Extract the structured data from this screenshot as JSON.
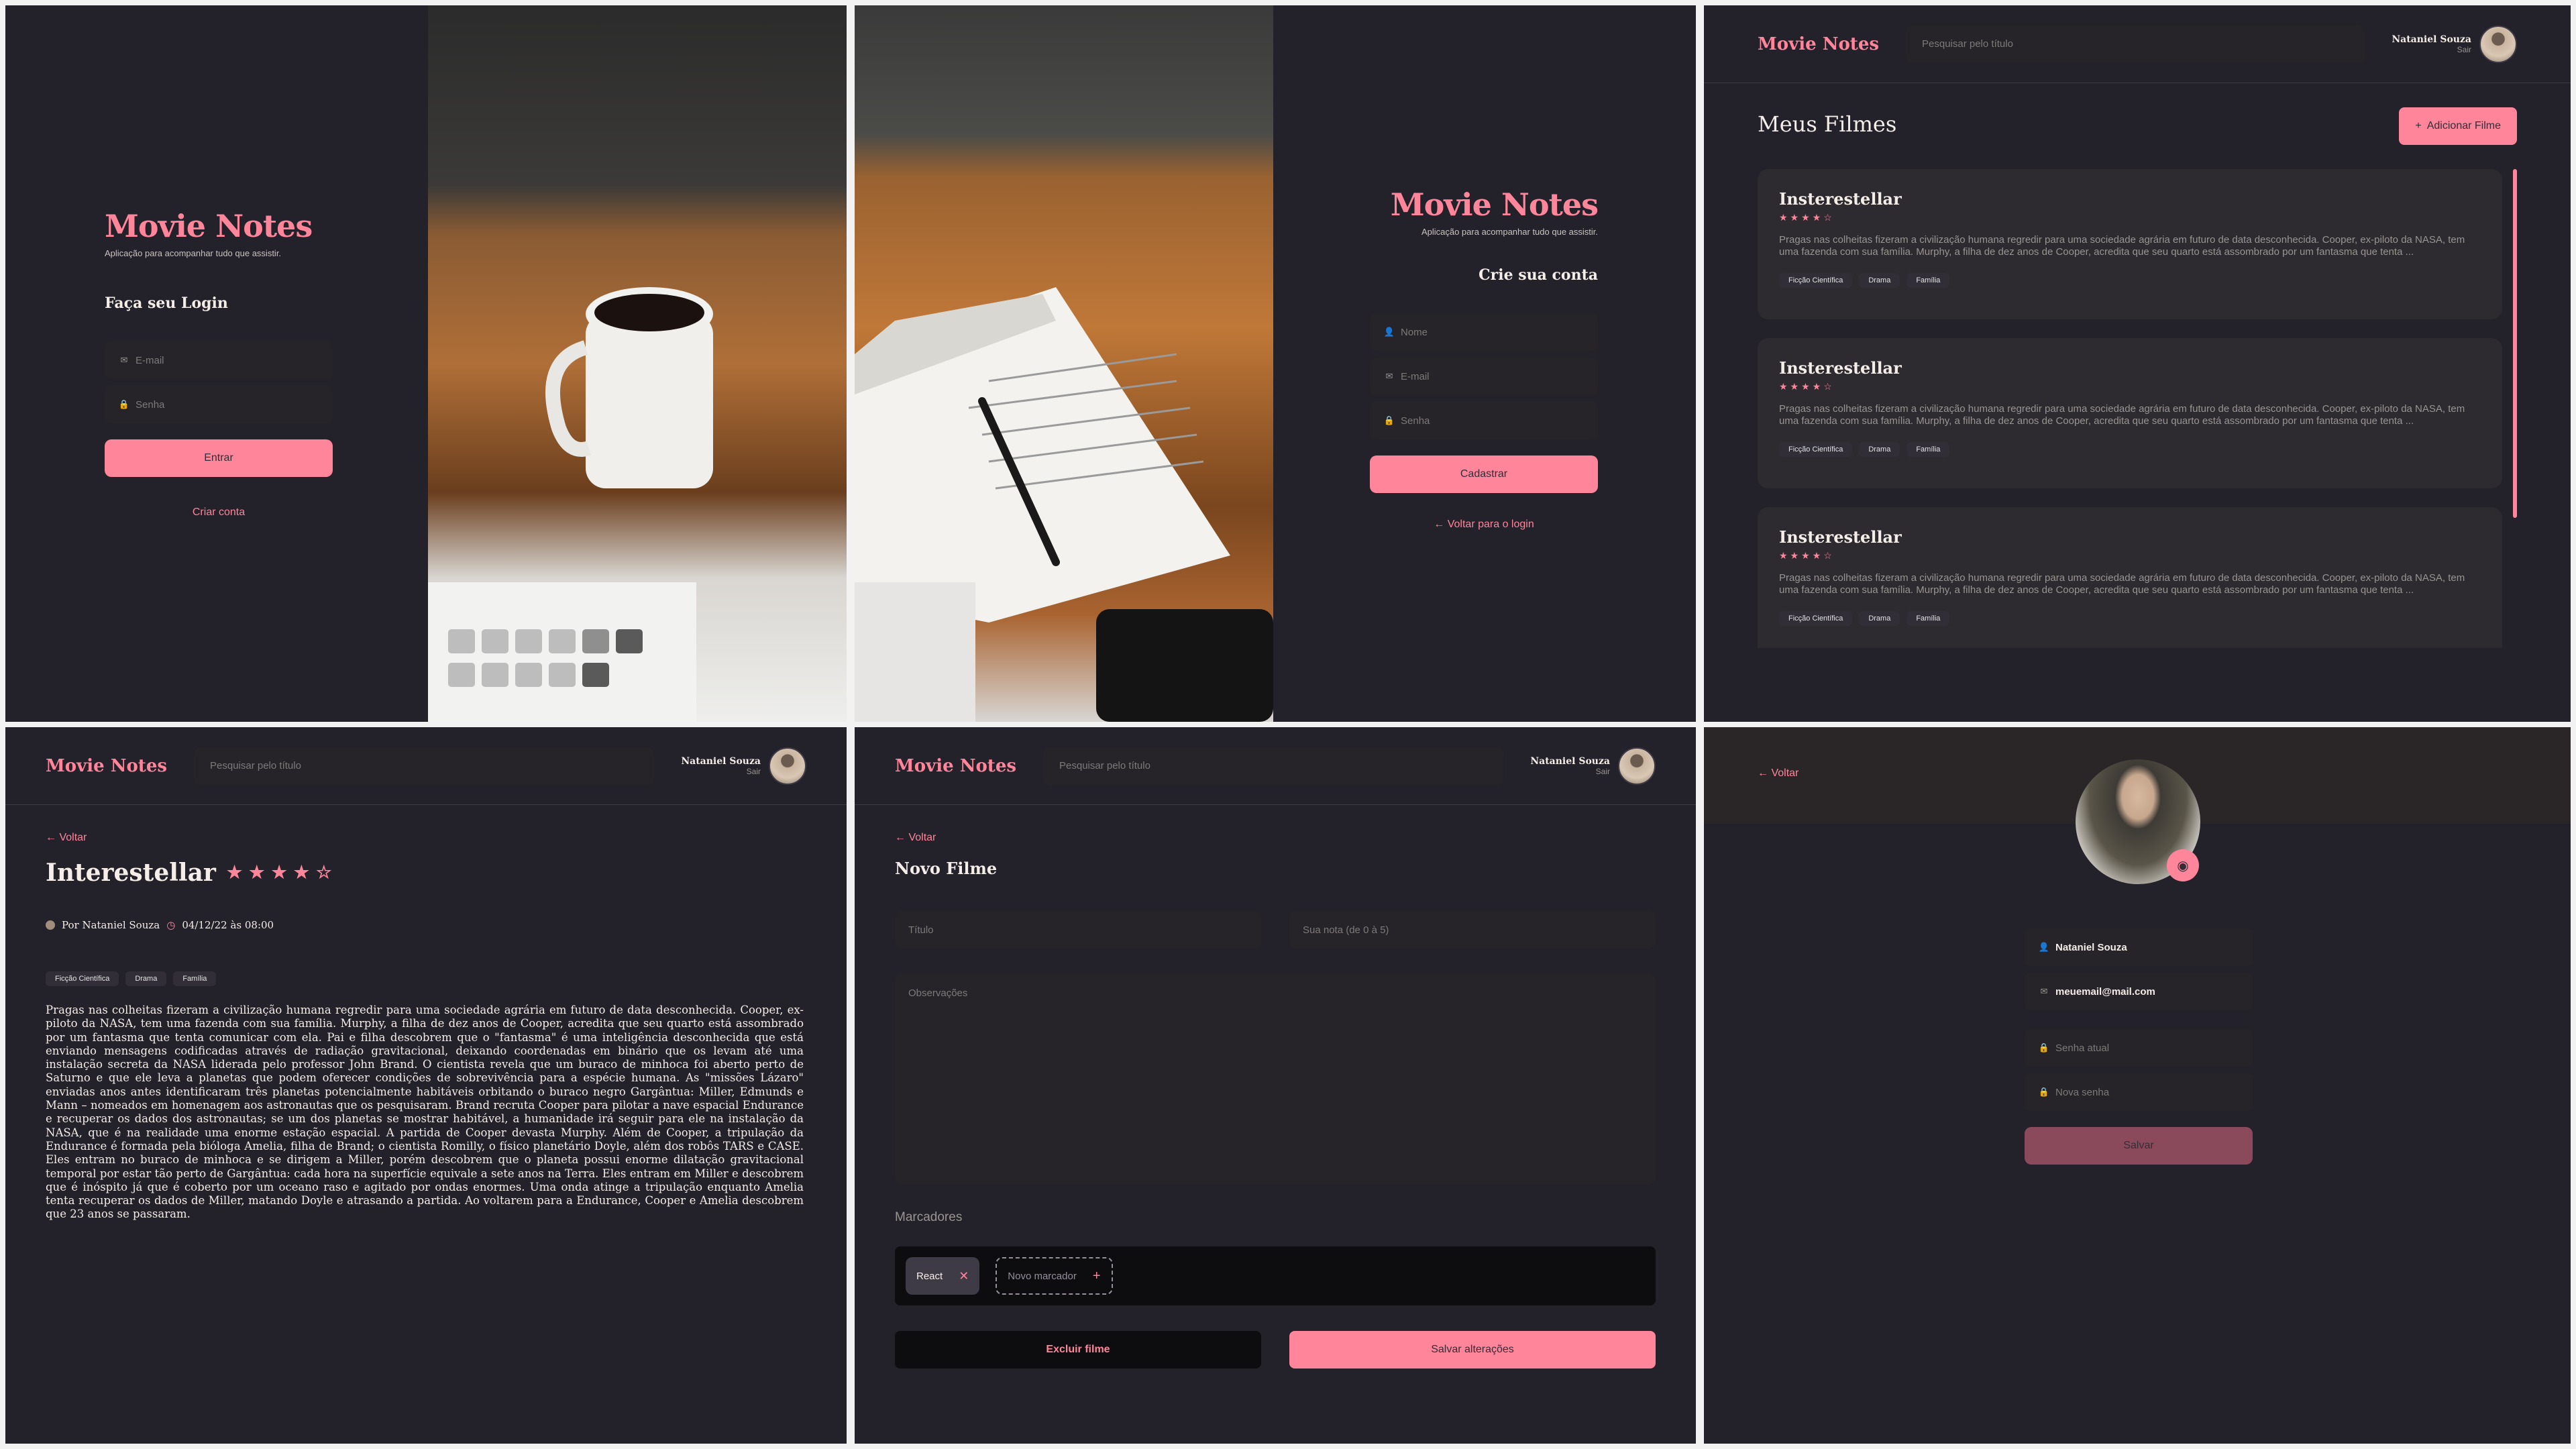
{
  "brand": "Movie Notes",
  "tagline": "Aplicação para acompanhar tudo que assistir.",
  "signin": {
    "heading": "Faça seu Login",
    "email_placeholder": "E-mail",
    "password_placeholder": "Senha",
    "submit": "Entrar",
    "create_link": "Criar conta"
  },
  "signup": {
    "heading": "Crie sua conta",
    "name_placeholder": "Nome",
    "email_placeholder": "E-mail",
    "password_placeholder": "Senha",
    "submit": "Cadastrar",
    "back_link": "Voltar para o login"
  },
  "header": {
    "search_placeholder": "Pesquisar pelo título",
    "user_name": "Nataniel Souza",
    "logout": "Sair"
  },
  "home": {
    "title": "Meus Filmes",
    "add_button": "Adicionar Filme",
    "movies": [
      {
        "title": "Insterestellar",
        "rating": "★★★★☆",
        "synopsis": "Pragas nas colheitas fizeram a civilização humana regredir para uma sociedade agrária em futuro de data desconhecida. Cooper, ex-piloto da NASA, tem uma fazenda com sua família. Murphy, a filha de dez anos de Cooper, acredita que seu quarto está assombrado por um fantasma que tenta ...",
        "tags": [
          "Ficção Científica",
          "Drama",
          "Família"
        ]
      },
      {
        "title": "Insterestellar",
        "rating": "★★★★☆",
        "synopsis": "Pragas nas colheitas fizeram a civilização humana regredir para uma sociedade agrária em futuro de data desconhecida. Cooper, ex-piloto da NASA, tem uma fazenda com sua família. Murphy, a filha de dez anos de Cooper, acredita que seu quarto está assombrado por um fantasma que tenta ...",
        "tags": [
          "Ficção Científica",
          "Drama",
          "Família"
        ]
      },
      {
        "title": "Insterestellar",
        "rating": "★★★★☆",
        "synopsis": "Pragas nas colheitas fizeram a civilização humana regredir para uma sociedade agrária em futuro de data desconhecida. Cooper, ex-piloto da NASA, tem uma fazenda com sua família. Murphy, a filha de dez anos de Cooper, acredita que seu quarto está assombrado por um fantasma que tenta ...",
        "tags": [
          "Ficção Científica",
          "Drama",
          "Família"
        ]
      }
    ]
  },
  "details": {
    "back": "Voltar",
    "title": "Interestellar",
    "rating": "★★★★☆",
    "author": "Por Nataniel Souza",
    "date": "04/12/22 às 08:00",
    "tags": [
      "Ficção Científica",
      "Drama",
      "Família"
    ],
    "body": "Pragas nas colheitas fizeram a civilização humana regredir para uma sociedade agrária em futuro de data desconhecida. Cooper, ex-piloto da NASA, tem uma fazenda com sua família. Murphy, a filha de dez anos de Cooper, acredita que seu quarto está assombrado por um fantasma que tenta comunicar com ela. Pai e filha descobrem que o \"fantasma\" é uma inteligência desconhecida que está enviando mensagens codificadas através de radiação gravitacional, deixando coordenadas em binário que os levam até uma instalação secreta da NASA liderada pelo professor John Brand. O cientista revela que um buraco de minhoca foi aberto perto de Saturno e que ele leva a planetas que podem oferecer condições de sobrevivência para a espécie humana. As \"missões Lázaro\" enviadas anos antes identificaram três planetas potencialmente habitáveis orbitando o buraco negro Gargântua: Miller, Edmunds e Mann – nomeados em homenagem aos astronautas que os pesquisaram. Brand recruta Cooper para pilotar a nave espacial Endurance e recuperar os dados dos astronautas; se um dos planetas se mostrar habitável, a humanidade irá seguir para ele na instalação da NASA, que é na realidade uma enorme estação espacial. A partida de Cooper devasta Murphy. Além de Cooper, a tripulação da Endurance é formada pela bióloga Amelia, filha de Brand; o cientista Romilly, o físico planetário Doyle, além dos robôs TARS e CASE. Eles entram no buraco de minhoca e se dirigem a Miller, porém descobrem que o planeta possui enorme dilatação gravitacional temporal por estar tão perto de Gargântua: cada hora na superfície equivale a sete anos na Terra. Eles entram em Miller e descobrem que é inóspito já que é coberto por um oceano raso e agitado por ondas enormes. Uma onda atinge a tripulação enquanto Amelia tenta recuperar os dados de Miller, matando Doyle e atrasando a partida. Ao voltarem para a Endurance, Cooper e Amelia descobrem que 23 anos se passaram."
  },
  "new_movie": {
    "back": "Voltar",
    "title": "Novo Filme",
    "title_placeholder": "Título",
    "rating_placeholder": "Sua nota (de 0 à 5)",
    "notes_placeholder": "Observações",
    "markers_label": "Marcadores",
    "marker_existing": "React",
    "marker_new_placeholder": "Novo marcador",
    "delete_button": "Excluir filme",
    "save_button": "Salvar alterações"
  },
  "profile": {
    "back": "Voltar",
    "name_value": "Nataniel Souza",
    "email_value": "meuemail@mail.com",
    "current_password_placeholder": "Senha atual",
    "new_password_placeholder": "Nova senha",
    "save_button": "Salvar"
  },
  "colors": {
    "background": "#232129",
    "accent": "#ff859b",
    "input": "#262429",
    "card": "#2d2a30"
  }
}
